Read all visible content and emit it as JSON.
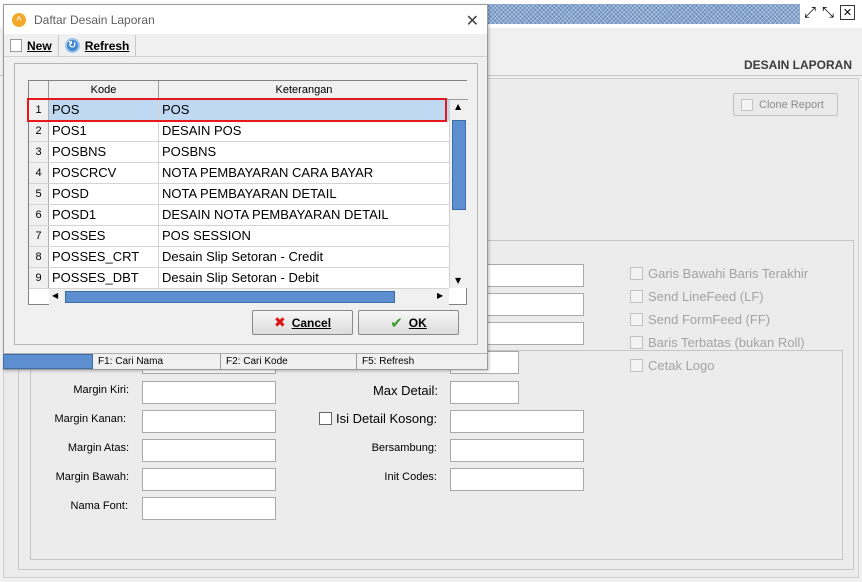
{
  "background_window": {
    "title": "DESAIN LAPORAN",
    "clone_button": "Clone Report",
    "labels": {
      "margin_kiri": "Margin Kiri:",
      "margin_kanan": "Margin Kanan:",
      "margin_atas": "Margin Atas:",
      "margin_bawah": "Margin Bawah:",
      "nama_font": "Nama Font:",
      "max_detail": "Max Detail:",
      "isi_detail_kosong": "Isi Detail Kosong:",
      "bersambung": "Bersambung:",
      "init_codes": "Init Codes:"
    },
    "options": [
      "Garis Bawahi Baris Terakhir",
      "Send LineFeed (LF)",
      "Send FormFeed (FF)",
      "Baris Terbatas (bukan Roll)",
      "Cetak Logo"
    ]
  },
  "dialog": {
    "title": "Daftar Desain Laporan",
    "toolbar": {
      "new_label": "New",
      "refresh_label": "Refresh"
    },
    "columns": {
      "kode": "Kode",
      "keterangan": "Keterangan"
    },
    "rows": [
      {
        "num": "1",
        "kode": "POS",
        "keterangan": "POS"
      },
      {
        "num": "2",
        "kode": "POS1",
        "keterangan": "DESAIN POS"
      },
      {
        "num": "3",
        "kode": "POSBNS",
        "keterangan": "POSBNS"
      },
      {
        "num": "4",
        "kode": "POSCRCV",
        "keterangan": "NOTA PEMBAYARAN CARA BAYAR"
      },
      {
        "num": "5",
        "kode": "POSD",
        "keterangan": "NOTA PEMBAYARAN DETAIL"
      },
      {
        "num": "6",
        "kode": "POSD1",
        "keterangan": "DESAIN NOTA PEMBAYARAN DETAIL"
      },
      {
        "num": "7",
        "kode": "POSSES",
        "keterangan": "POS SESSION"
      },
      {
        "num": "8",
        "kode": "POSSES_CRT",
        "keterangan": "Desain Slip Setoran - Credit"
      },
      {
        "num": "9",
        "kode": "POSSES_DBT",
        "keterangan": "Desain Slip Setoran - Debit"
      }
    ],
    "cancel_label": "Cancel",
    "ok_label": "OK",
    "status": {
      "f1": "F1: Cari Nama",
      "f2": "F2: Cari Kode",
      "f5": "F5: Refresh"
    }
  },
  "colors": {
    "selection": "#bfd9f2",
    "highlight_border": "#e4191c",
    "scroll_thumb": "#5d8ed0"
  }
}
